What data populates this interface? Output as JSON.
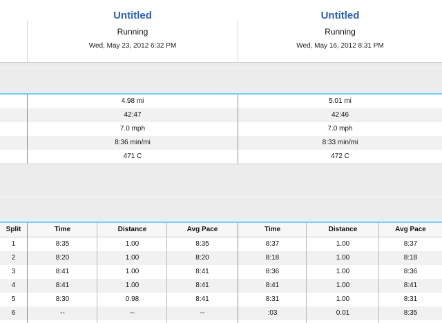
{
  "workouts": [
    {
      "title": "Untitled",
      "sport": "Running",
      "date": "Wed, May 23, 2012 6:32 PM"
    },
    {
      "title": "Untitled",
      "sport": "Running",
      "date": "Wed, May 16, 2012 8:31 PM"
    }
  ],
  "summary": [
    [
      "4.98 mi",
      "5.01 mi"
    ],
    [
      "42:47",
      "42:46"
    ],
    [
      "7.0 mph",
      "7.0 mph"
    ],
    [
      "8:36 min/mi",
      "8:33 min/mi"
    ],
    [
      "471 C",
      "472 C"
    ]
  ],
  "splits": {
    "split_header": "Split",
    "headers": [
      "Time",
      "Distance",
      "Avg Pace"
    ],
    "rows": [
      {
        "split": "1",
        "a": [
          "8:35",
          "1.00",
          "8:35"
        ],
        "b": [
          "8:37",
          "1.00",
          "8:37"
        ]
      },
      {
        "split": "2",
        "a": [
          "8:20",
          "1.00",
          "8:20"
        ],
        "b": [
          "8:18",
          "1.00",
          "8:18"
        ]
      },
      {
        "split": "3",
        "a": [
          "8:41",
          "1.00",
          "8:41"
        ],
        "b": [
          "8:36",
          "1.00",
          "8:36"
        ]
      },
      {
        "split": "4",
        "a": [
          "8:41",
          "1.00",
          "8:41"
        ],
        "b": [
          "8:41",
          "1.00",
          "8:41"
        ]
      },
      {
        "split": "5",
        "a": [
          "8:30",
          "0.98",
          "8:41"
        ],
        "b": [
          "8:31",
          "1.00",
          "8:31"
        ]
      },
      {
        "split": "6",
        "a": [
          "--",
          "--",
          "--"
        ],
        "b": [
          ":03",
          "0.01",
          "8:35"
        ]
      }
    ]
  }
}
